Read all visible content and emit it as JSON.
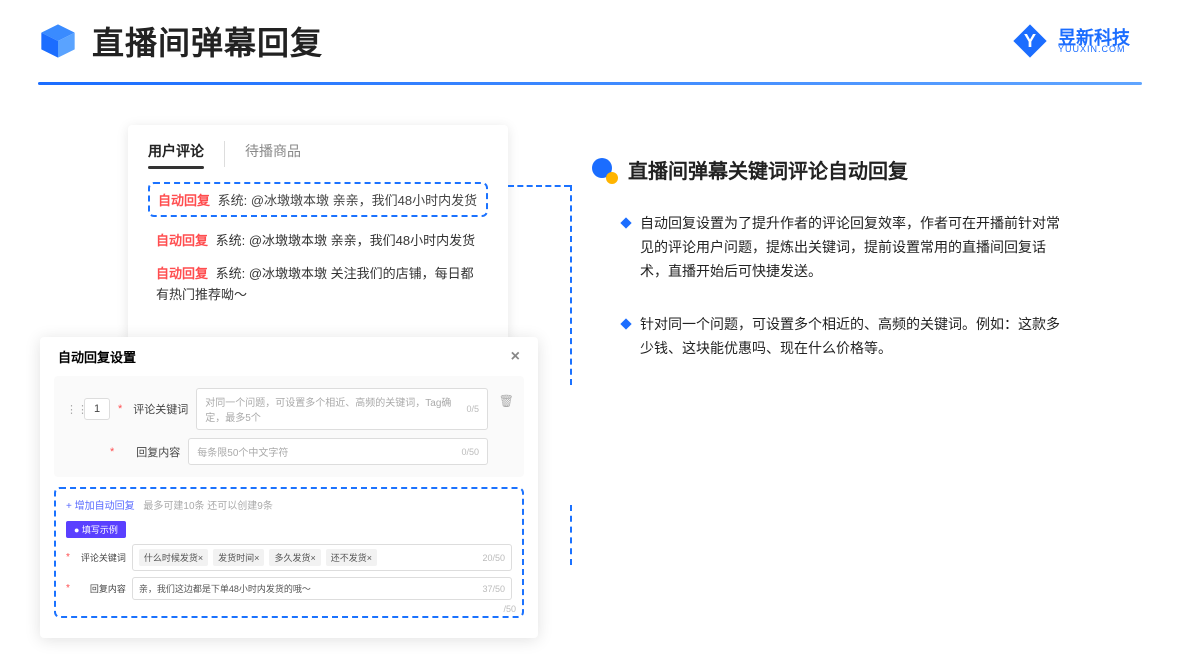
{
  "header": {
    "title": "直播间弹幕回复",
    "brand_name": "昱新科技",
    "brand_sub": "YUUXIN.COM"
  },
  "right": {
    "section_title": "直播间弹幕关键词评论自动回复",
    "bullet1": "自动回复设置为了提升作者的评论回复效率，作者可在开播前针对常见的评论用户问题，提炼出关键词，提前设置常用的直播间回复话术，直播开始后可快捷发送。",
    "bullet2": "针对同一个问题，可设置多个相近的、高频的关键词。例如：这款多少钱、这块能优惠吗、现在什么价格等。"
  },
  "top_card": {
    "tab1": "用户评论",
    "tab2": "待播商品",
    "r1_tag": "自动回复",
    "r1_text": " 系统: @冰墩墩本墩 亲亲，我们48小时内发货",
    "r2_tag": "自动回复",
    "r2_text": " 系统: @冰墩墩本墩 亲亲，我们48小时内发货",
    "r3_tag": "自动回复",
    "r3_text": " 系统: @冰墩墩本墩 关注我们的店铺，每日都有热门推荐呦～"
  },
  "modal": {
    "title": "自动回复设置",
    "close": "×",
    "index": "1",
    "label_keyword": "评论关键词",
    "placeholder_keyword": "对同一个问题，可设置多个相近、高频的关键词，Tag确定，最多5个",
    "counter_keyword": "0/5",
    "label_content": "回复内容",
    "placeholder_content": "每条限50个中文字符",
    "counter_content": "0/50",
    "add_link": "+ 增加自动回复",
    "add_hint": "最多可建10条 还可以创建9条",
    "example_btn": "● 填写示例",
    "ex_label_kw": "评论关键词",
    "ex_kw_tags": [
      "什么时候发货×",
      "发货时间×",
      "多久发货×",
      "还不发货×"
    ],
    "ex_kw_counter": "20/50",
    "ex_label_ct": "回复内容",
    "ex_content_value": "亲，我们这边都是下单48小时内发货的哦～",
    "ex_ct_counter": "37/50",
    "outer_counter": "/50"
  }
}
